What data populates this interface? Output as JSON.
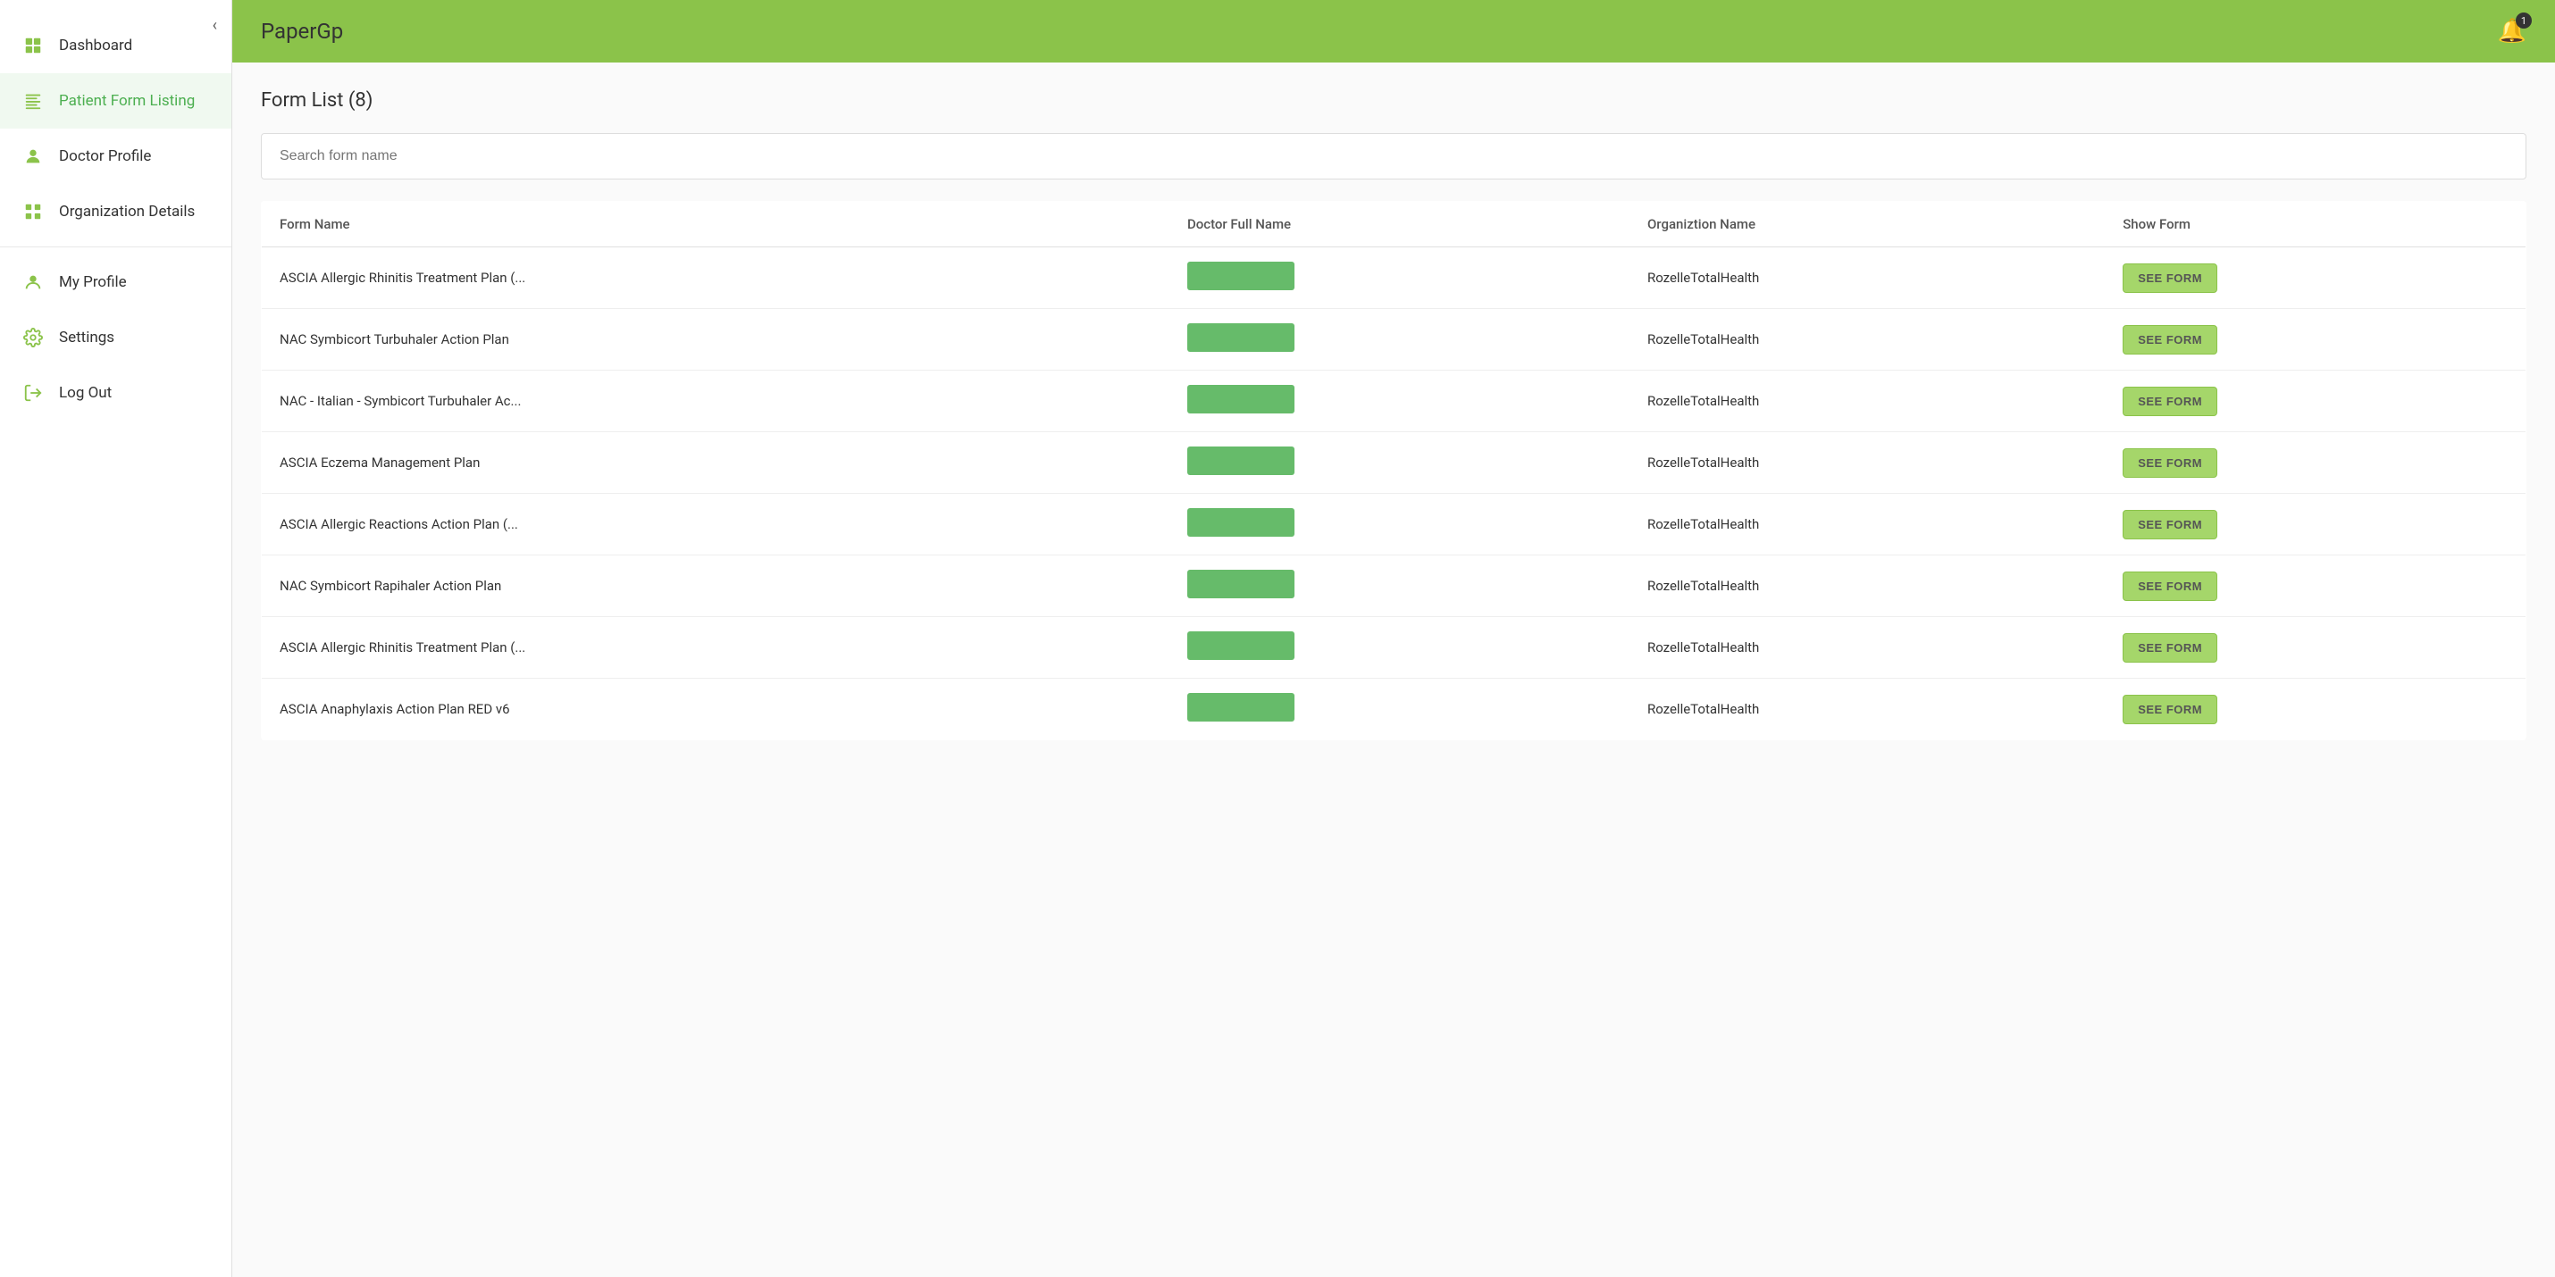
{
  "app": {
    "title": "PaperGp",
    "bell_badge": "1"
  },
  "sidebar": {
    "collapse_icon": "‹",
    "items": [
      {
        "id": "dashboard",
        "label": "Dashboard",
        "icon": "grid"
      },
      {
        "id": "patient-form-listing",
        "label": "Patient Form Listing",
        "icon": "list",
        "active": true
      },
      {
        "id": "doctor-profile",
        "label": "Doctor Profile",
        "icon": "person-circle"
      },
      {
        "id": "organization-details",
        "label": "Organization Details",
        "icon": "grid-list"
      },
      {
        "id": "my-profile",
        "label": "My Profile",
        "icon": "person"
      },
      {
        "id": "settings",
        "label": "Settings",
        "icon": "gear"
      },
      {
        "id": "log-out",
        "label": "Log Out",
        "icon": "logout"
      }
    ]
  },
  "main": {
    "page_title": "Form List (8)",
    "search_placeholder": "Search form name",
    "table": {
      "columns": [
        "Form Name",
        "Doctor Full Name",
        "Organiztion Name",
        "Show Form"
      ],
      "rows": [
        {
          "form_name": "ASCIA Allergic Rhinitis Treatment Plan (...",
          "org_name": "RozelleTotalHealth",
          "btn": "SEE FORM"
        },
        {
          "form_name": "NAC Symbicort Turbuhaler Action Plan",
          "org_name": "RozelleTotalHealth",
          "btn": "SEE FORM"
        },
        {
          "form_name": "NAC - Italian - Symbicort Turbuhaler Ac...",
          "org_name": "RozelleTotalHealth",
          "btn": "SEE FORM"
        },
        {
          "form_name": "ASCIA Eczema Management Plan",
          "org_name": "RozelleTotalHealth",
          "btn": "SEE FORM"
        },
        {
          "form_name": "ASCIA Allergic Reactions Action Plan (...",
          "org_name": "RozelleTotalHealth",
          "btn": "SEE FORM"
        },
        {
          "form_name": "NAC Symbicort Rapihaler Action Plan",
          "org_name": "RozelleTotalHealth",
          "btn": "SEE FORM"
        },
        {
          "form_name": "ASCIA Allergic Rhinitis Treatment Plan (...",
          "org_name": "RozelleTotalHealth",
          "btn": "SEE FORM"
        },
        {
          "form_name": "ASCIA Anaphylaxis Action Plan RED v6",
          "org_name": "RozelleTotalHealth",
          "btn": "SEE FORM"
        }
      ]
    }
  }
}
